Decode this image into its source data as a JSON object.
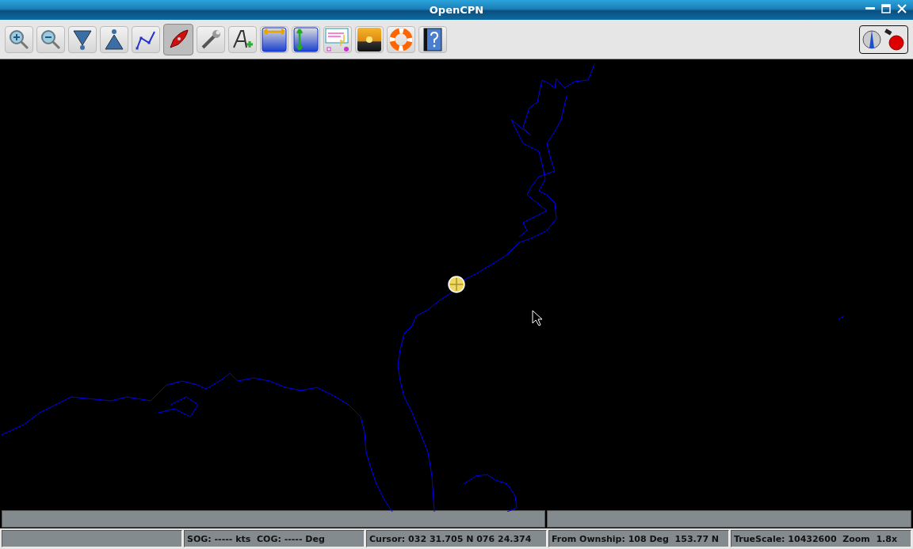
{
  "window": {
    "title": "OpenCPN"
  },
  "toolbar": [
    {
      "kind": "zoom-in",
      "selected": false
    },
    {
      "kind": "zoom-out",
      "selected": false
    },
    {
      "kind": "scale-down",
      "selected": false
    },
    {
      "kind": "scale-up",
      "selected": false
    },
    {
      "kind": "route",
      "selected": false
    },
    {
      "kind": "boat",
      "selected": true
    },
    {
      "kind": "wrench",
      "selected": false
    },
    {
      "kind": "text",
      "selected": false
    },
    {
      "kind": "tide",
      "selected": false
    },
    {
      "kind": "current",
      "selected": false
    },
    {
      "kind": "chart",
      "selected": false
    },
    {
      "kind": "sunset",
      "selected": false
    },
    {
      "kind": "lifebuoy",
      "selected": false
    },
    {
      "kind": "help",
      "selected": false
    }
  ],
  "status_bar": [
    {
      "text": "SOG: ----- kts  COG: ----- Deg"
    },
    {
      "text": "Cursor: 032 31.705 N 076 24.374"
    },
    {
      "text": "From Ownship: 108 Deg  153.77 N"
    },
    {
      "text": "TrueScale: 10432600  Zoom  1.8x"
    }
  ]
}
